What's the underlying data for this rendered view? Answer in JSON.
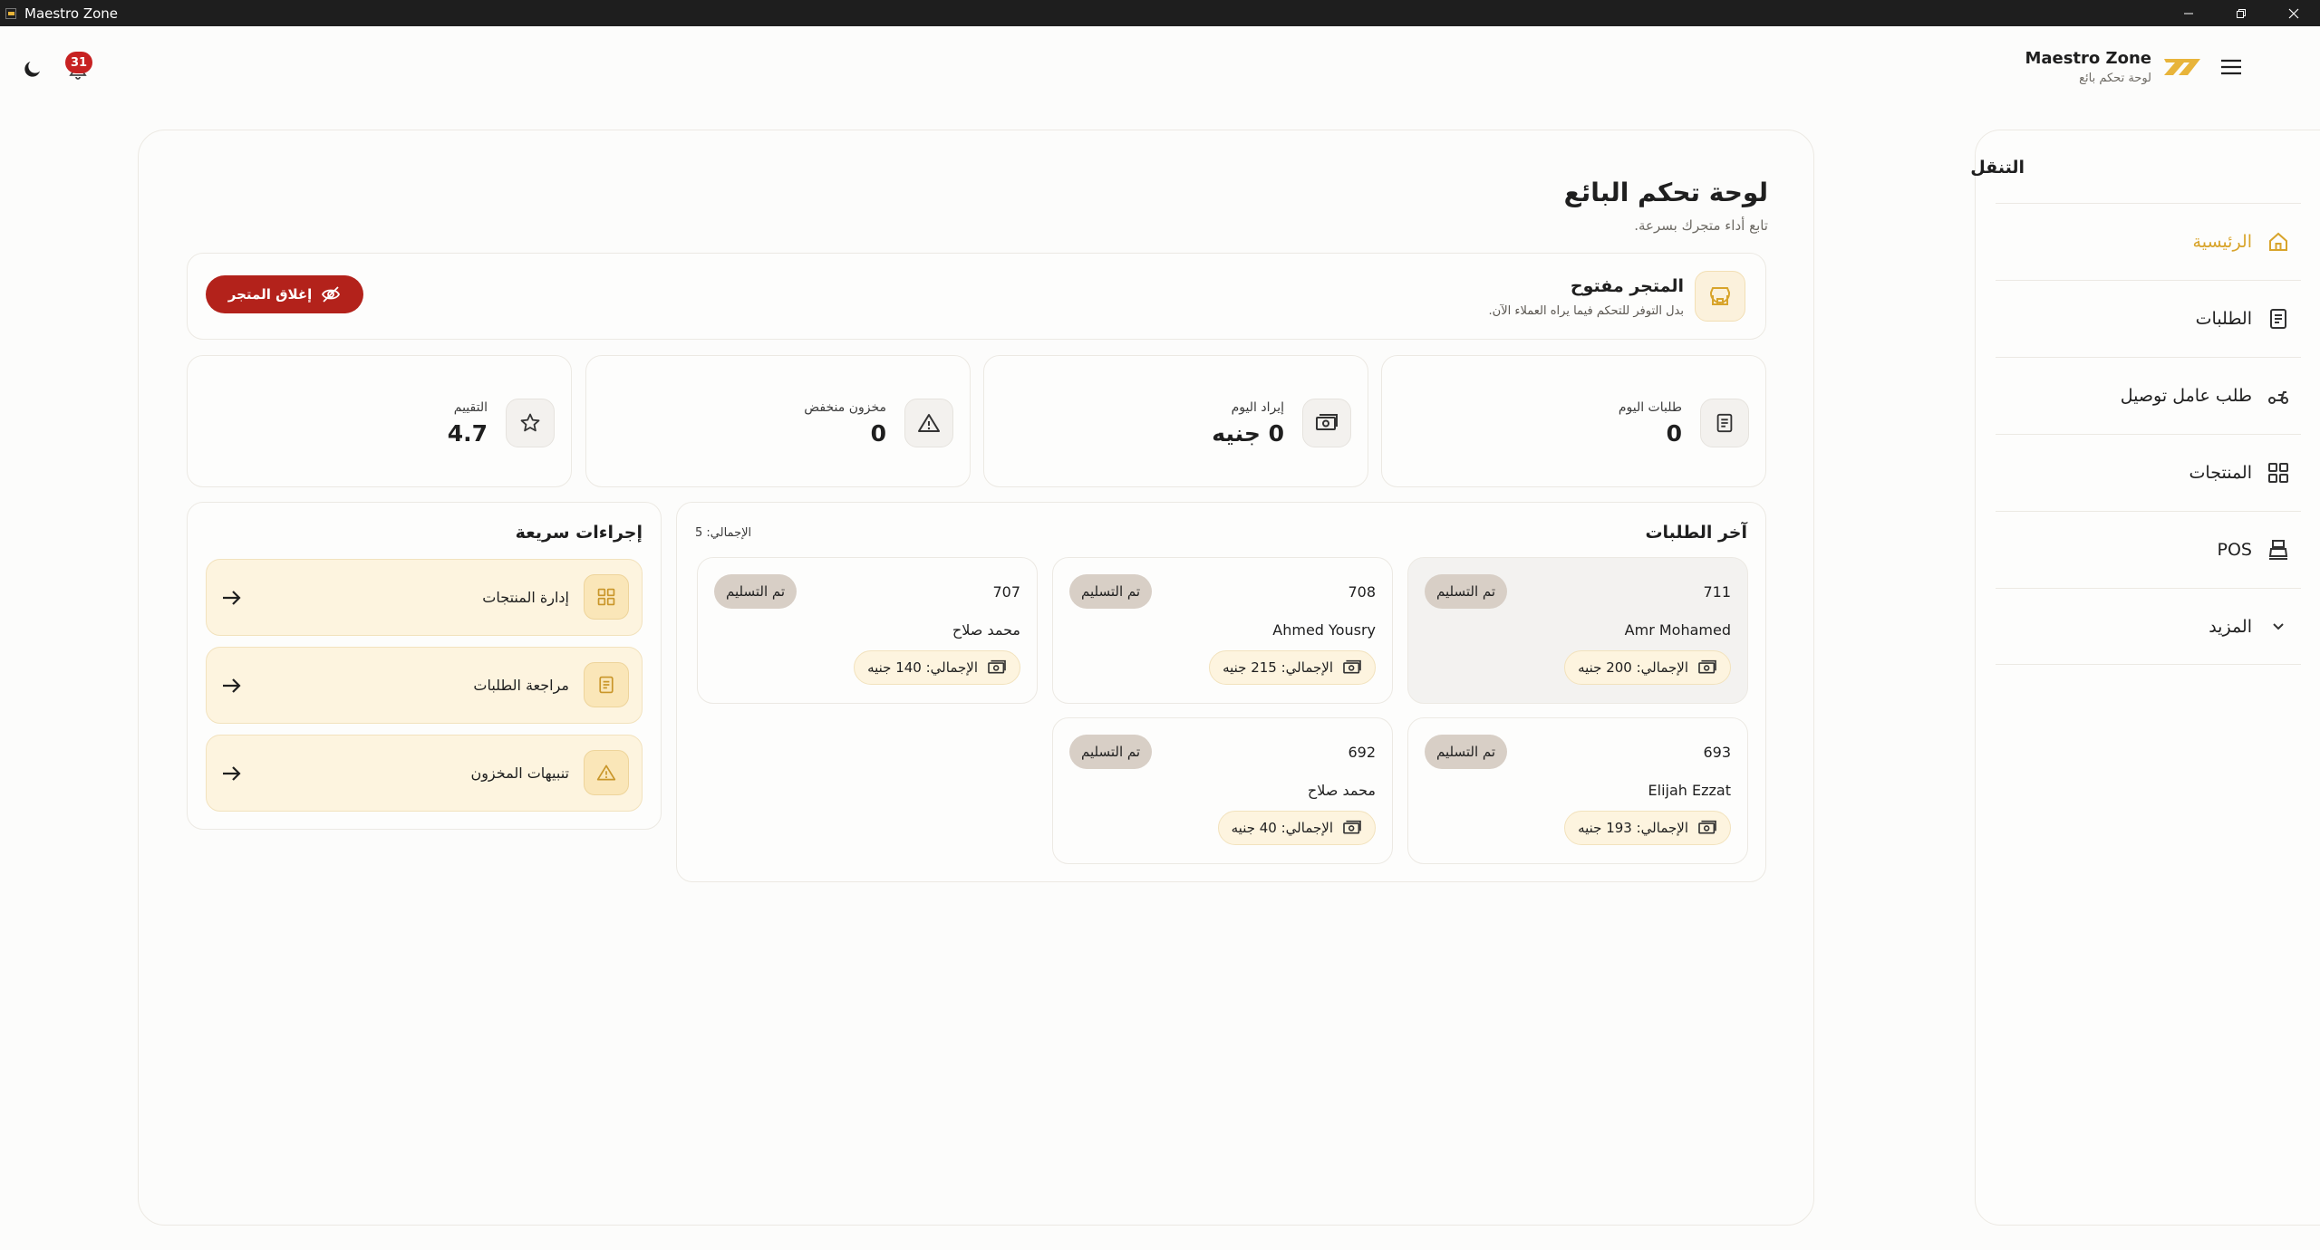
{
  "window": {
    "title": "Maestro Zone"
  },
  "header": {
    "notifications_count": "31",
    "brand_name": "Maestro Zone",
    "brand_subtitle": "لوحة تحكم بائع",
    "accent_color": "#e8b43a"
  },
  "sidebar": {
    "title": "التنقل",
    "items": [
      {
        "label": "الرئيسية",
        "icon": "home-icon",
        "active": true
      },
      {
        "label": "الطلبات",
        "icon": "receipt-icon"
      },
      {
        "label": "طلب عامل توصيل",
        "icon": "scooter-icon"
      },
      {
        "label": "المنتجات",
        "icon": "grid-icon"
      },
      {
        "label": "POS",
        "icon": "cash-register-icon"
      },
      {
        "label": "المزيد",
        "icon": "chevron-down-icon"
      }
    ]
  },
  "page": {
    "title": "لوحة تحكم البائع",
    "subtitle": "تابع أداء متجرك بسرعة."
  },
  "store": {
    "title": "المتجر مفتوح",
    "subtitle": "بدل التوفر للتحكم فيما يراه العملاء الآن.",
    "close_label": "إغلاق المتجر",
    "close_color": "#b3221b"
  },
  "stats": {
    "today_orders": {
      "label": "طلبات اليوم",
      "value": "0"
    },
    "today_revenue": {
      "label": "إيراد اليوم",
      "value": "0 جنيه"
    },
    "low_stock": {
      "label": "مخزون منخفض",
      "value": "0"
    },
    "rating": {
      "label": "التقييم",
      "value": "4.7"
    }
  },
  "orders": {
    "title": "آخر الطلبات",
    "total": "الإجمالي: 5",
    "items": [
      {
        "number": "711",
        "customer": "Amr Mohamed",
        "status": "تم التسليم",
        "total": "الإجمالي: 200 جنيه"
      },
      {
        "number": "708",
        "customer": "Ahmed Yousry",
        "status": "تم التسليم",
        "total": "الإجمالي: 215 جنيه"
      },
      {
        "number": "707",
        "customer": "محمد صلاح",
        "status": "تم التسليم",
        "total": "الإجمالي: 140 جنيه"
      },
      {
        "number": "693",
        "customer": "Elijah Ezzat",
        "status": "تم التسليم",
        "total": "الإجمالي: 193 جنيه"
      },
      {
        "number": "692",
        "customer": "محمد صلاح",
        "status": "تم التسليم",
        "total": "الإجمالي: 40 جنيه"
      }
    ]
  },
  "quick_actions": {
    "title": "إجراءات سريعة",
    "items": [
      {
        "label": "إدارة المنتجات",
        "icon": "grid-icon"
      },
      {
        "label": "مراجعة الطلبات",
        "icon": "receipt-icon"
      },
      {
        "label": "تنبيهات المخزون",
        "icon": "warning-icon"
      }
    ]
  }
}
